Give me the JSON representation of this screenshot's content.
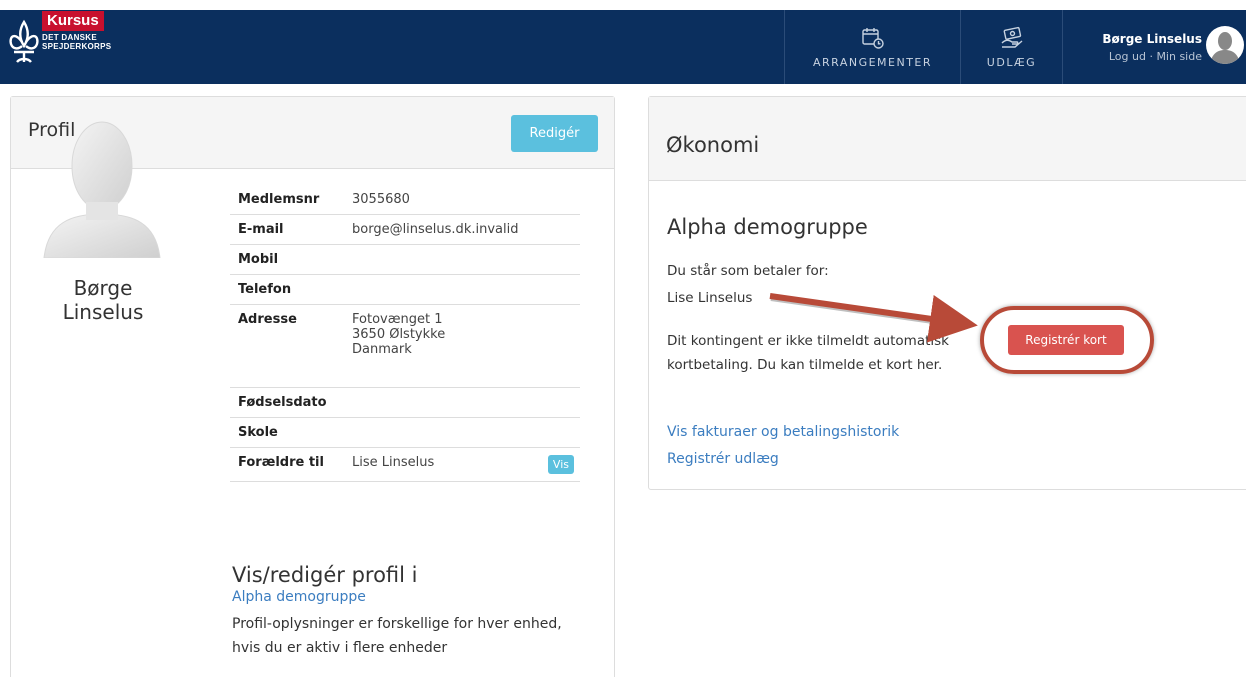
{
  "navbar": {
    "logo_badge": "Kursus",
    "logo_line1": "DET DANSKE",
    "logo_line2": "SPEJDERKORPS",
    "items": [
      {
        "label": "ARRANGEMENTER",
        "icon": "calendar-clock-icon"
      },
      {
        "label": "UDLÆG",
        "icon": "money-hand-icon"
      }
    ],
    "user": {
      "name": "Børge Linselus",
      "logout": "Log ud",
      "separator": "·",
      "my_page": "Min side"
    }
  },
  "profile": {
    "title": "Profil",
    "edit_button": "Redigér",
    "name": "Børge Linselus",
    "fields": {
      "member_no_label": "Medlemsnr",
      "member_no": "3055680",
      "email_label": "E-mail",
      "email": "borge@linselus.dk.invalid",
      "mobile_label": "Mobil",
      "mobile": "",
      "phone_label": "Telefon",
      "phone": "",
      "address_label": "Adresse",
      "address_line1": "Fotovænget 1",
      "address_line2": "3650 Ølstykke",
      "address_line3": "Danmark",
      "birthdate_label": "Fødselsdato",
      "birthdate": "",
      "school_label": "Skole",
      "school": "",
      "parent_label": "Forældre til",
      "parent_of": "Lise Linselus",
      "view_button": "Vis"
    },
    "view_edit_title": "Vis/redigér profil i",
    "group_link": "Alpha demogruppe",
    "note": "Profil-oplysninger er forskellige for hver enhed, hvis du er aktiv i flere enheder"
  },
  "economy": {
    "title": "Økonomi",
    "group_name": "Alpha demogruppe",
    "payer_intro": "Du står som betaler for:",
    "payer_for": "Lise Linselus",
    "subscription_text": "Dit kontingent er ikke tilmeldt automatisk kortbetaling. Du kan tilmelde et kort her.",
    "register_card_button": "Registrér kort",
    "invoices_link": "Vis fakturaer og betalingshistorik",
    "register_expense_link": "Registrér udlæg"
  },
  "colors": {
    "navbar": "#0b2f5e",
    "info_button": "#5bc0de",
    "danger_button": "#d9534f",
    "link": "#3b7dc0",
    "annotation": "#b84a38",
    "logo_badge": "#c8102e"
  }
}
